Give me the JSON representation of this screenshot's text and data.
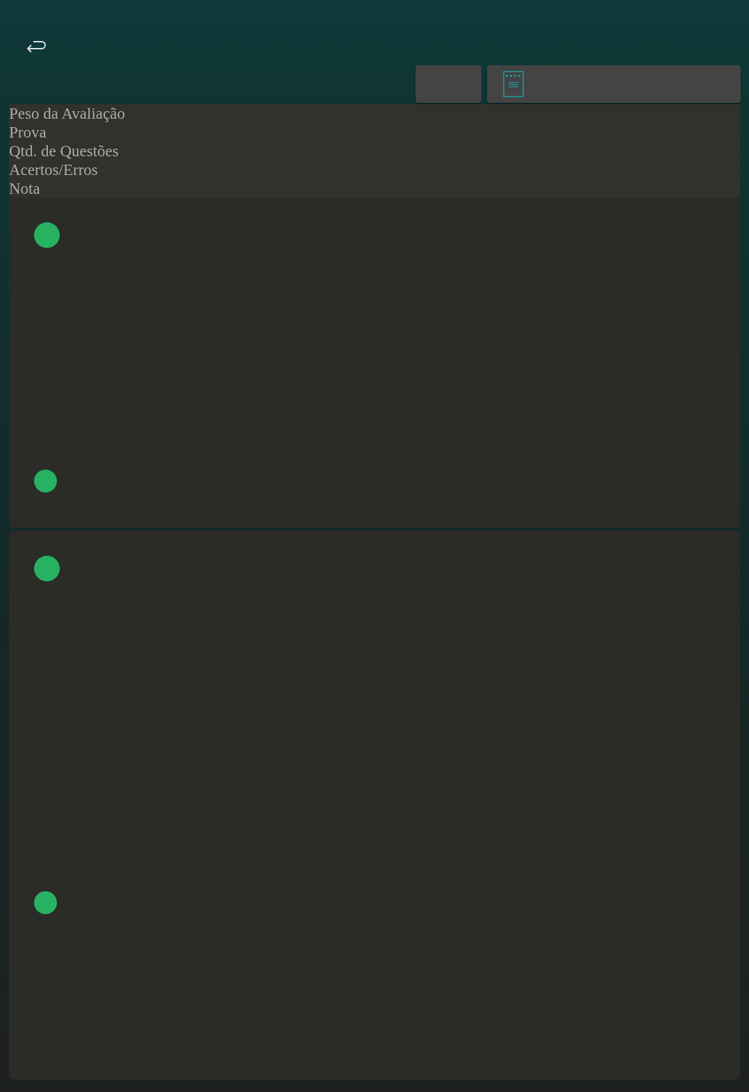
{
  "header": {
    "buttons": [
      {
        "kind": "blank"
      },
      {
        "kind": "document"
      }
    ]
  },
  "columns": [
    "Peso da Avaliação",
    "Prova",
    "Qtd. de Questões",
    "Acertos/Erros",
    "Nota"
  ],
  "cards": [
    {
      "markers": [
        {
          "color": "#27b262"
        },
        {
          "color": "#27b262"
        }
      ]
    },
    {
      "markers": [
        {
          "color": "#27b262"
        },
        {
          "color": "#27b262"
        }
      ]
    }
  ]
}
